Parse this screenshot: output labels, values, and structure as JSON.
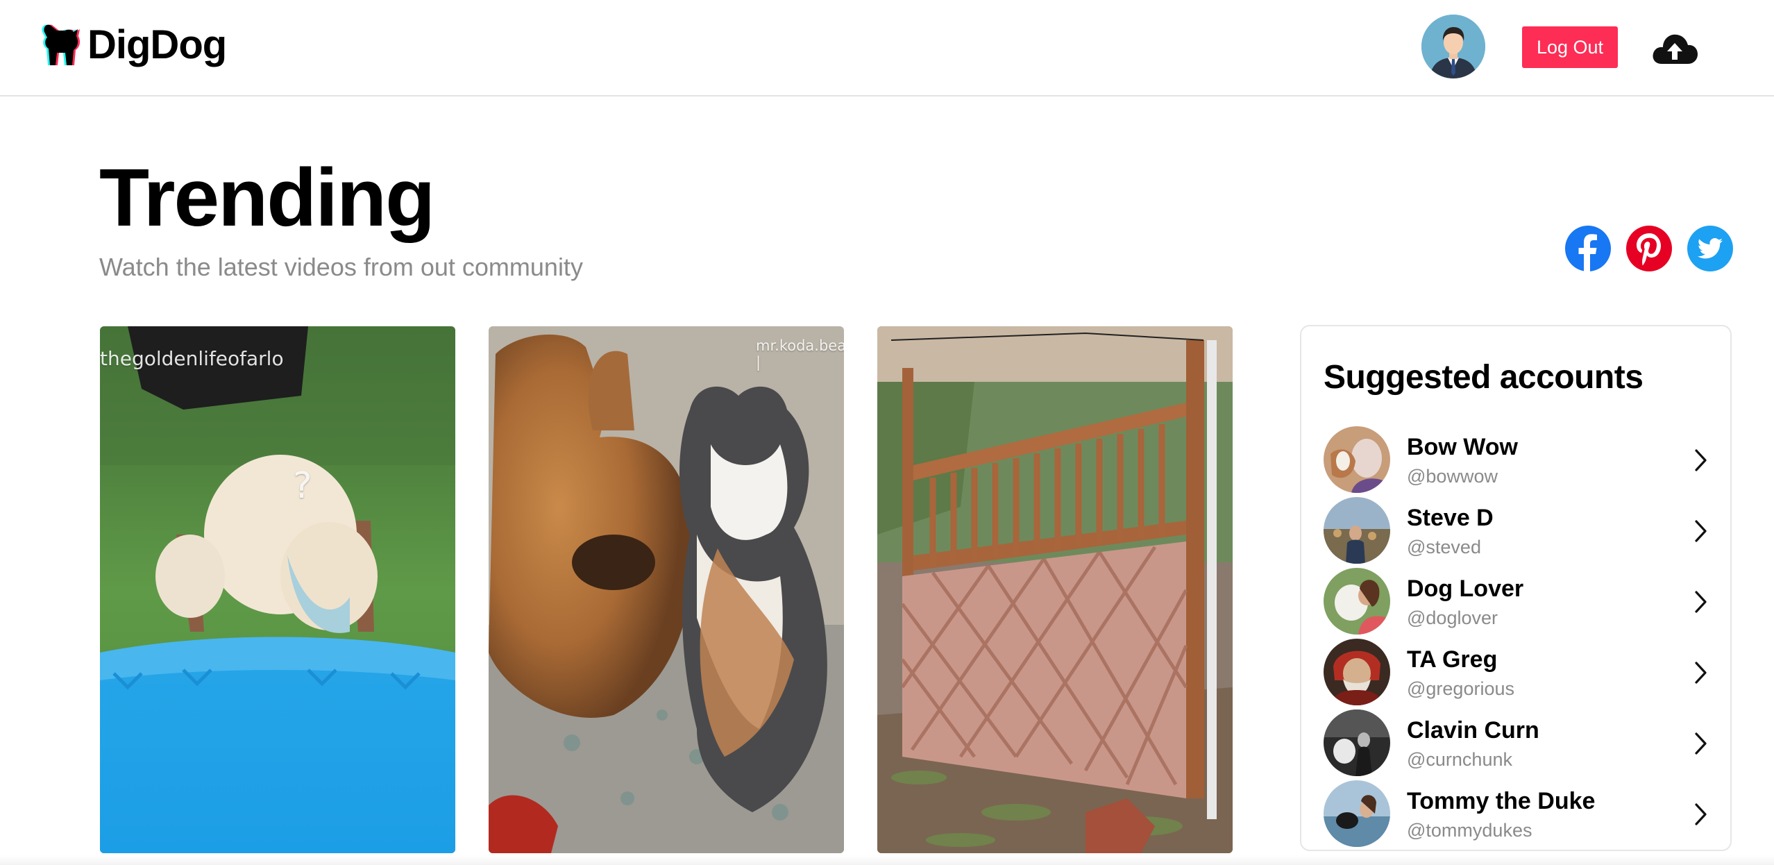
{
  "app": {
    "name": "DigDog"
  },
  "header": {
    "logout_label": "Log Out",
    "icons": [
      "dog-logo-icon",
      "user-avatar",
      "upload-cloud-icon"
    ]
  },
  "page": {
    "title": "Trending",
    "subtitle": "Watch the latest videos from out community"
  },
  "social": [
    {
      "name": "facebook",
      "icon": "facebook-icon",
      "color": "#1877f2"
    },
    {
      "name": "pinterest",
      "icon": "pinterest-icon",
      "color": "#e60023"
    },
    {
      "name": "twitter",
      "icon": "twitter-icon",
      "color": "#1da1f2"
    }
  ],
  "videos": [
    {
      "watermark": "thegoldenlifeofarlo",
      "overlay_glyph": "?"
    },
    {
      "watermark": "mr.koda.bear |"
    },
    {
      "watermark": ""
    }
  ],
  "suggested": {
    "title": "Suggested accounts",
    "accounts": [
      {
        "name": "Bow Wow",
        "handle": "@bowwow"
      },
      {
        "name": "Steve D",
        "handle": "@steved"
      },
      {
        "name": "Dog Lover",
        "handle": "@doglover"
      },
      {
        "name": "TA Greg",
        "handle": "@gregorious"
      },
      {
        "name": "Clavin Curn",
        "handle": "@curnchunk"
      },
      {
        "name": "Tommy the Duke",
        "handle": "@tommydukes"
      }
    ]
  },
  "colors": {
    "accent": "#fd2d55",
    "subtitle": "#8a8a8a",
    "border": "#e6e6e6"
  }
}
